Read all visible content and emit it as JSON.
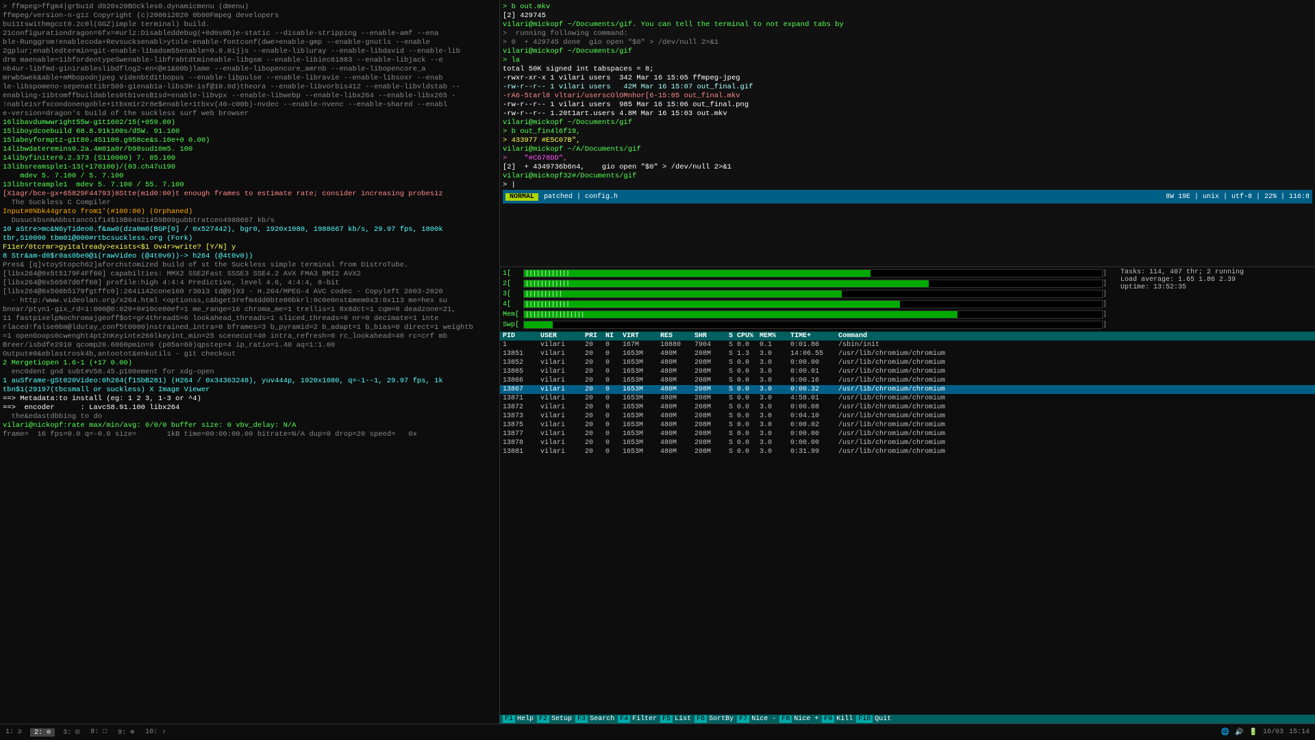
{
  "left_terminal": {
    "lines": [
      {
        "text": "> ffmpeg>ffgm4|grbu1d d920x20BOckles0.dynamicmenu (dmenu)",
        "color": "gray"
      },
      {
        "text": "ffmpeg/version-n-g1z Copyright (c)2000i2020 0b00Fmpeg developers",
        "color": "gray"
      },
      {
        "text": "bu11tswithmgcct0.2c0l(GGZ)imple terminal) build.",
        "color": "gray"
      },
      {
        "text": "21configurationdragon=6fx=#urlz:Disableddebug(+0d0s0b)e-static --disable-stripping --enable-amf --ena",
        "color": "gray"
      },
      {
        "text": "ble-Runggrom!enablecoda+Revsucksenabl>ytole-enable-fontconf(dwe>enable-gmp --enable-gnutls --enable",
        "color": "gray"
      },
      {
        "text": "2gplur;enabledtermin=git-enable-libadsm55enable=0.0.0ij)s --enable-libluray --enable-libdavid --enable-lib",
        "color": "gray"
      },
      {
        "text": "drm maenable=1ibfordeotypeSwenable-libfrabtdtmineable-libgsm --enable-libiec61883 --enable-libjack --e",
        "color": "gray"
      },
      {
        "text": "nb4ur-libfmd-ginirableslibdflog2-en<@e1&00b)lame --enable-libopencore_amrnb --enable-libopencore_a",
        "color": "gray"
      },
      {
        "text": "mrwbSwek&able+mMbopodnjpeg videnbtd1tbopus --enable-libpulse --enable-libravie --enable-libsoxr --enab",
        "color": "gray"
      },
      {
        "text": "le-libspomeno-sepenattibr509-gienab1a-libs3H-isf@10.0d)theora --enable-libvorbis412 --enable-libvldstab --",
        "color": "gray"
      },
      {
        "text": "enabling-1ibtomffbuildables0tb1vesB1sd=enable-libvpx --enable-libwebp --enable-libx264 --enable-libx265 -",
        "color": "gray"
      },
      {
        "text": "!nable1srfxcondonengoble+1tbxm1r2r8e$enable+1tbxv(40-c00b)-nvdec --enable-nvenc --enable-shared --enabl",
        "color": "gray"
      },
      {
        "text": "e-version=dragon's build of the suckless surf web browser",
        "color": "gray"
      },
      {
        "text": "16libavdumwwright55w-g1t1602/15(+059.00)",
        "color": "green"
      },
      {
        "text": "15liboydcoebuild 68.8.91k100s/d5W. 91.100",
        "color": "green"
      },
      {
        "text": "15labeyformptz-g1t80.4S1100.g958ce&s.10e+0 0.00)",
        "color": "green"
      },
      {
        "text": "14libwdateremins0.2a.4m01a0r/b98sud10m5. 100",
        "color": "green"
      },
      {
        "text": "14libyfiniter0.2.373 (S110000) 7. 85.100",
        "color": "green"
      },
      {
        "text": "13libsreamsple1-13(+170100)/(03.ch47u190",
        "color": "green"
      },
      {
        "text": "    mdev 5. 7.100 / 5. 7.100",
        "color": "green"
      },
      {
        "text": "13libsrteample1  mdev 5. 7.100 / 55. 7.100",
        "color": "green"
      },
      {
        "text": "[X1agr/bce-gx+65829F44793)8Stte(m1d0:00)t enough frames to estimate rate; consider increasing probesiz",
        "color": "bright-red"
      },
      {
        "text": "  The Suckless C Compiler",
        "color": "gray"
      },
      {
        "text": "Input#0%bk44grato from1'(#100:00) (Orphaned)",
        "color": "orange"
      },
      {
        "text": "  DusuckbsnNAbbstancOif14$19B04021459B09gubbtratceo4988667 kb/s",
        "color": "gray"
      },
      {
        "text": "10 aStre>mc&N6yTideo0.f&aw0(dza0m0(BGP[0] / 0x527442), bgr0, 1920x1080, 1988667 kb/s, 29.97 fps, 1800k",
        "color": "cyan"
      },
      {
        "text": "tbr,S10000 tbm01@000#rtbcsuckless.org (Fork)",
        "color": "cyan"
      },
      {
        "text": "F11er/0tcrmr>gy1talready>exists<$1 Ov4r>write? [Y/N] y",
        "color": "yellow"
      },
      {
        "text": "8 Str&am-d0$r0as0be0@1(rawVideo (@4t0v0))-> h264 (@4t0v0))",
        "color": "cyan"
      },
      {
        "text": "Pres& [q]vtoyStopch62]aforchstomized build of st the Suckless simple terminal from DistroTube.",
        "color": "gray"
      },
      {
        "text": "[libx264@0x5t5179F4Ff60] capabilties: MMX2 SSE2Fast SSSE3 SSE4.2 AVX FMA3 BMI2 AVX2",
        "color": "gray"
      },
      {
        "text": "[libx264@0x56507d6ff60] profile:high 4:4:4 Predictive, level 4.6, 4:4:4, 8-bit",
        "color": "gray"
      },
      {
        "text": "[libx264@0x560b5179fgtffc0]:264i142cone160 r3013 td@9)93 - H.264/MPEG-4 AVC codec - Copyleft 2003-2020",
        "color": "gray"
      },
      {
        "text": "  - http:/www.videolan.org/x264.html <optionss,c&bget3refm4dd0bte00bkrl:0c0e0nst&mem0x3:0x113 me=hex su",
        "color": "gray"
      },
      {
        "text": "bnear/ptyn1-gix_rd=1:000@0:020+0#10ce00ef=1 me_range=16 chroma_me=1 trellis=1 8x8dct=1 cqm=0 deadzone=21,",
        "color": "gray"
      },
      {
        "text": "11 fastpixelpNochromajgeoff$ot=gr4threadS=6 lookahead_threads=1 sliced_threads=0 nr=0 decimate=1 inte",
        "color": "gray"
      },
      {
        "text": "rlaced!false0bm@ldutay_conf5t0000)nstrained_intra=0 bframes=3 b_pyramid=2 b_adapt=1 b_bias=0 direct=1 weightb",
        "color": "gray"
      },
      {
        "text": "=1 openGoops0cwenght4pt2nKeyinte260lkeyint_min=25 scenecut=40 intra_refresh=0 rc_lookahead=40 rc=crf mb",
        "color": "gray"
      },
      {
        "text": "Breer/isbdfe2910 qcomp20.6060pmin=0 (p05a=69)qpstep=4 ip_ratio=1.40 aq=1:1.00",
        "color": "gray"
      },
      {
        "text": "Output#0&eblastrosk4b,antootot&enkutils - git checkout",
        "color": "gray"
      },
      {
        "text": "2 Mergetiopen 1.6-1 (+17 0.00)",
        "color": "green"
      },
      {
        "text": "  enc0dent gnd subt#V58.45.p100ement for xdg-open",
        "color": "gray"
      },
      {
        "text": "1 auSframe-gSt020Video:0h264(f1SbB281) (H264 / 0x34363248), yuv444p, 1920x1080, q=-1--1, 29.97 fps, 1k",
        "color": "cyan"
      },
      {
        "text": "tbn$1(29197(tbcsmall or suckless) X Image Viewer",
        "color": "cyan"
      },
      {
        "text": "==> Metadata:to install (eg: 1 2 3, 1-3 or ^4)",
        "color": "white"
      },
      {
        "text": "==>  encoder      : LavcS8.91.100 libx264",
        "color": "white"
      },
      {
        "text": "  the&edastdbbing to do",
        "color": "gray"
      },
      {
        "text": "vilari@nickopf:rate max/min/avg: 0/0/0 buffer size: 0 vbv_delay: N/A",
        "color": "green"
      },
      {
        "text": "frame=  16 fps=0.0 q=-0.0 size=       1kB time=00:00:00.00 bitrate=N/A dup=0 drop=20 speed=   0x",
        "color": "gray"
      }
    ]
  },
  "right_top_terminal": {
    "title": "vilari@mickopf: ~/Documents/gif",
    "lines": [
      {
        "text": "> b out.mkv",
        "color": "green"
      },
      {
        "text": "[2] 429745",
        "color": "white"
      },
      {
        "text": "vilari@mickopf ~/Documents/gif. You can tell the terminal to not expand tabs by",
        "color": "green"
      },
      {
        "text": ">  running following command:",
        "color": "gray"
      },
      {
        "text": "> 0  + 429745 done  gio open \"$0\" > /dev/null 2>&1",
        "color": "gray"
      },
      {
        "text": "vilari@mickopf ~/Documents/gif",
        "color": "green"
      },
      {
        "text": "> la",
        "color": "green"
      },
      {
        "text": "total 50K signed int tabspaces = 8;",
        "color": "white"
      },
      {
        "text": "-rwxr-xr-x 1 vilari users  342 Mar 16 15:05 ffmpeg-jpeg",
        "color": "white"
      },
      {
        "text": "-rw-r--r-- 1 vilari users   42M Mar 16 15:07 out_final.gif",
        "color": "bright-cyan"
      },
      {
        "text": "-rA6-5tarl8 vltari/userscOlOMnhor[6-15:05 out_final.mkv",
        "color": "bright-red"
      },
      {
        "text": "-rw-r--r-- 1 vilari users  985 Mar 16 15:06 out_final.png",
        "color": "white"
      },
      {
        "text": "-rw-r--r-- 1.20t1art.users 4.8M Mar 16 15:03 out.mkv",
        "color": "white"
      },
      {
        "text": "vilari@mickopf ~/Documents/gif",
        "color": "green"
      },
      {
        "text": "> b out_fin4l6f19,",
        "color": "green"
      },
      {
        "text": "> 433977 #E5C07B\",",
        "color": "yellow"
      },
      {
        "text": "vilari@mickopf ~/A/Documents/gif",
        "color": "green"
      },
      {
        "text": ">    \"#C678DD\",",
        "color": "magenta"
      },
      {
        "text": "[2]  + 4349736b6n4,    gio open \"$0\" > /dev/null 2>&1",
        "color": "white"
      },
      {
        "text": "vilari@mickopf32#/Documents/gif",
        "color": "green"
      },
      {
        "text": "> |",
        "color": "white"
      }
    ],
    "vim_statusline": {
      "mode": "NORMAL",
      "flags": "patched | config.h",
      "right": "8W 19E | unix | utf-8 | 22% | 116:8"
    }
  },
  "htop": {
    "cpu_bars": [
      {
        "label": "1[",
        "fill": 0.6,
        "text": "||||||||||||"
      },
      {
        "label": "2[",
        "fill": 0.7,
        "text": "||||||||||||"
      },
      {
        "label": "3[",
        "fill": 0.55,
        "text": "||||||||||"
      },
      {
        "label": "4[",
        "fill": 0.65,
        "text": "||||||||||||"
      }
    ],
    "mem_bar": {
      "label": "Mem[",
      "fill": 0.75,
      "text": "||||||||||||||||"
    },
    "swp_bar": {
      "label": "Swp[",
      "fill": 0.05,
      "text": "|"
    },
    "stats": {
      "tasks": "Tasks: 114, 407 thr; 2 running",
      "load": "Load average: 1.65 1.86 2.39",
      "uptime": "Uptime: 13:52:35"
    },
    "columns": [
      "PID",
      "USER",
      "PRI",
      "NI",
      "VIRT",
      "RES",
      "SHR",
      "S",
      "CPU%",
      "MEM%",
      "TIME+",
      "Command"
    ],
    "processes": [
      {
        "pid": "1",
        "user": "vilari",
        "pri": "20",
        "ni": "0",
        "virt": "167M",
        "res": "10880",
        "shr": "7904",
        "s": "S",
        "cpu": "0.0",
        "mem": "0.1",
        "time": "0:01.86",
        "cmd": "/sbin/init"
      },
      {
        "pid": "13851",
        "user": "vilari",
        "pri": "20",
        "ni": "0",
        "virt": "1653M",
        "res": "480M",
        "shr": "208M",
        "s": "S",
        "cpu": "1.3",
        "mem": "3.0",
        "time": "14:06.55",
        "cmd": "/usr/lib/chromium/chromium"
      },
      {
        "pid": "13852",
        "user": "vilari",
        "pri": "20",
        "ni": "0",
        "virt": "1653M",
        "res": "480M",
        "shr": "208M",
        "s": "S",
        "cpu": "0.0",
        "mem": "3.0",
        "time": "0:00.00",
        "cmd": "/usr/lib/chromium/chromium"
      },
      {
        "pid": "13865",
        "user": "vilari",
        "pri": "20",
        "ni": "0",
        "virt": "1653M",
        "res": "480M",
        "shr": "208M",
        "s": "S",
        "cpu": "0.0",
        "mem": "3.0",
        "time": "0:00.01",
        "cmd": "/usr/lib/chromium/chromium"
      },
      {
        "pid": "13866",
        "user": "vilari",
        "pri": "20",
        "ni": "0",
        "virt": "1653M",
        "res": "480M",
        "shr": "208M",
        "s": "S",
        "cpu": "0.0",
        "mem": "3.0",
        "time": "0:00.16",
        "cmd": "/usr/lib/chromium/chromium"
      },
      {
        "pid": "13867",
        "user": "vilari",
        "pri": "20",
        "ni": "0",
        "virt": "1653M",
        "res": "480M",
        "shr": "208M",
        "s": "S",
        "cpu": "0.0",
        "mem": "3.0",
        "time": "0:00.32",
        "cmd": "/usr/lib/chromium/chromium",
        "selected": true
      },
      {
        "pid": "13871",
        "user": "vilari",
        "pri": "20",
        "ni": "0",
        "virt": "1653M",
        "res": "480M",
        "shr": "208M",
        "s": "S",
        "cpu": "0.0",
        "mem": "3.0",
        "time": "4:58.01",
        "cmd": "/usr/lib/chromium/chromium"
      },
      {
        "pid": "13872",
        "user": "vilari",
        "pri": "20",
        "ni": "0",
        "virt": "1653M",
        "res": "480M",
        "shr": "208M",
        "s": "S",
        "cpu": "0.0",
        "mem": "3.0",
        "time": "0:00.08",
        "cmd": "/usr/lib/chromium/chromium"
      },
      {
        "pid": "13873",
        "user": "vilari",
        "pri": "20",
        "ni": "0",
        "virt": "1653M",
        "res": "480M",
        "shr": "208M",
        "s": "S",
        "cpu": "0.0",
        "mem": "3.0",
        "time": "0:04.10",
        "cmd": "/usr/lib/chromium/chromium"
      },
      {
        "pid": "13875",
        "user": "vilari",
        "pri": "20",
        "ni": "0",
        "virt": "1653M",
        "res": "480M",
        "shr": "208M",
        "s": "S",
        "cpu": "0.0",
        "mem": "3.0",
        "time": "0:00.02",
        "cmd": "/usr/lib/chromium/chromium"
      },
      {
        "pid": "13877",
        "user": "vilari",
        "pri": "20",
        "ni": "0",
        "virt": "1653M",
        "res": "480M",
        "shr": "208M",
        "s": "S",
        "cpu": "0.0",
        "mem": "3.0",
        "time": "0:00.00",
        "cmd": "/usr/lib/chromium/chromium"
      },
      {
        "pid": "13878",
        "user": "vilari",
        "pri": "20",
        "ni": "0",
        "virt": "1653M",
        "res": "480M",
        "shr": "208M",
        "s": "S",
        "cpu": "0.0",
        "mem": "3.0",
        "time": "0:00.00",
        "cmd": "/usr/lib/chromium/chromium"
      },
      {
        "pid": "13881",
        "user": "vilari",
        "pri": "20",
        "ni": "0",
        "virt": "1653M",
        "res": "480M",
        "shr": "208M",
        "s": "S",
        "cpu": "0.0",
        "mem": "3.0",
        "time": "0:31.99",
        "cmd": "/usr/lib/chromium/chromium"
      }
    ],
    "footer": [
      {
        "key": "F1",
        "label": "Help"
      },
      {
        "key": "F2",
        "label": "Setup"
      },
      {
        "key": "F3",
        "label": "Search"
      },
      {
        "key": "F4",
        "label": "Filter"
      },
      {
        "key": "F5",
        "label": "List"
      },
      {
        "key": "F6",
        "label": "SortBy"
      },
      {
        "key": "F7",
        "label": "Nice -"
      },
      {
        "key": "F8",
        "label": "Nice +"
      },
      {
        "key": "F9",
        "label": "Kill"
      },
      {
        "key": "F10",
        "label": "Quit"
      }
    ]
  },
  "taskbar": {
    "items": [
      {
        "label": "1: ≥",
        "active": false
      },
      {
        "label": "2: ⊙",
        "active": true
      },
      {
        "label": "3: ⊡",
        "active": false
      },
      {
        "label": "8: □",
        "active": false
      },
      {
        "label": "9: ⊕",
        "active": false
      },
      {
        "label": "10: ♪",
        "active": false
      }
    ]
  },
  "systray": {
    "icons": [
      "🔊",
      "📶",
      "🔋"
    ],
    "date": "16/03",
    "time": "15:14"
  },
  "search_label": "Search"
}
